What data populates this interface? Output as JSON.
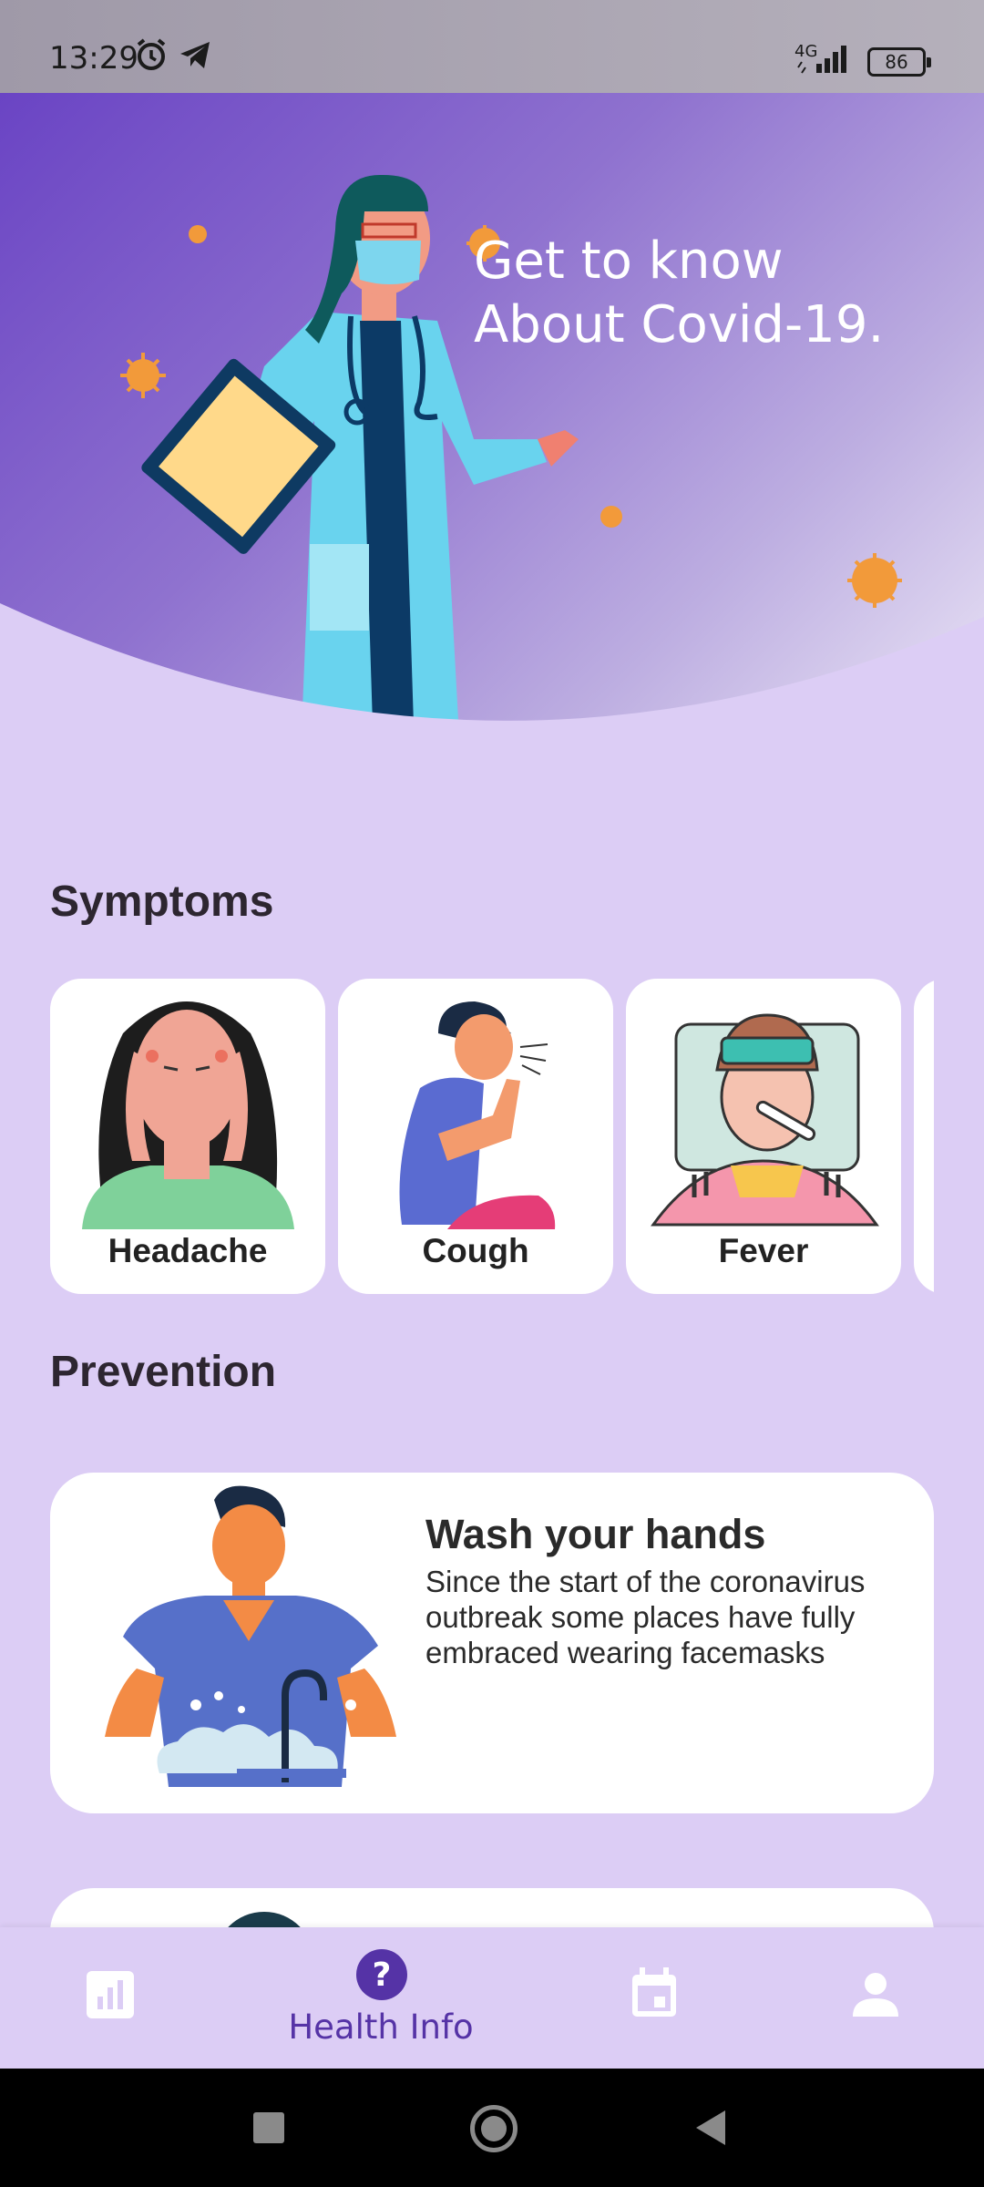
{
  "status_bar": {
    "time": "13:29",
    "network": "4G",
    "battery": "86",
    "icons": [
      "alarm-icon",
      "telegram-icon",
      "signal-icon",
      "battery-icon"
    ]
  },
  "hero": {
    "title_line1": "Get to know",
    "title_line2": "About Covid-19."
  },
  "symptoms": {
    "title": "Symptoms",
    "items": [
      {
        "label": "Headache"
      },
      {
        "label": "Cough"
      },
      {
        "label": "Fever"
      }
    ]
  },
  "prevention": {
    "title": "Prevention",
    "items": [
      {
        "title": "Wash your hands",
        "text": "Since the start of the coronavirus outbreak some places have fully embraced wearing facemasks"
      }
    ]
  },
  "bottom_nav": {
    "items": [
      {
        "icon": "stats-icon",
        "label": ""
      },
      {
        "icon": "help-icon",
        "label": "Health Info",
        "active": true
      },
      {
        "icon": "calendar-icon",
        "label": ""
      },
      {
        "icon": "person-icon",
        "label": ""
      }
    ],
    "active_color": "#5533a6",
    "inactive_color": "#ffffff"
  },
  "colors": {
    "background": "#dccdf5",
    "hero_start": "#6a44c4",
    "card": "#ffffff"
  }
}
